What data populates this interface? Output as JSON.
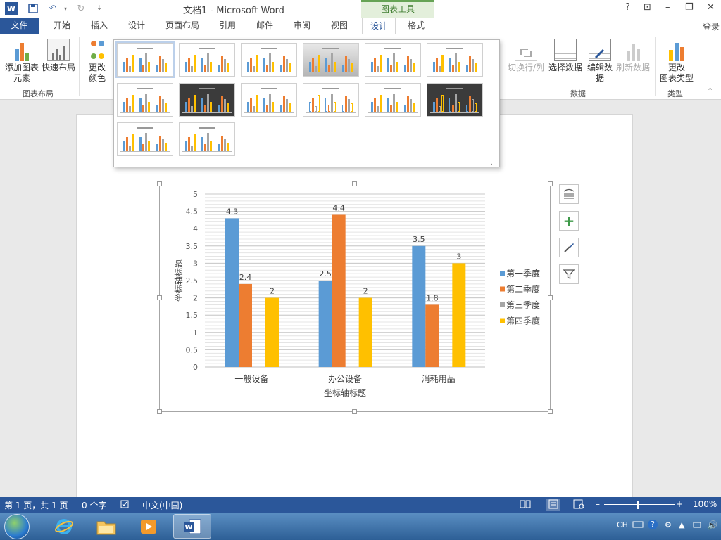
{
  "titlebar": {
    "title": "文档1 - Microsoft Word",
    "context_tab": "图表工具",
    "help": "?",
    "restore_ribbon": "⊡",
    "minimize": "–",
    "restore": "❐",
    "close": "✕"
  },
  "tabs": [
    {
      "label": "文件"
    },
    {
      "label": "开始"
    },
    {
      "label": "插入"
    },
    {
      "label": "设计"
    },
    {
      "label": "页面布局"
    },
    {
      "label": "引用"
    },
    {
      "label": "邮件"
    },
    {
      "label": "审阅"
    },
    {
      "label": "视图"
    },
    {
      "label": "设计"
    },
    {
      "label": "格式"
    }
  ],
  "login": "登录",
  "ribbon": {
    "add_element": [
      "添加图表",
      "元素"
    ],
    "quick_layout": "快速布局",
    "change_colors": [
      "更改",
      "颜色"
    ],
    "group_layout": "图表布局",
    "switch_row_col": "切换行/列",
    "select_data": "选择数据",
    "edit_data": [
      "编辑数",
      "据"
    ],
    "refresh_data": "刷新数据",
    "group_data": "数据",
    "change_type": [
      "更改",
      "图表类型"
    ],
    "group_type": "类型"
  },
  "colors": {
    "series1": "#5b9bd5",
    "series2": "#ed7d31",
    "series3": "#a5a5a5",
    "series4": "#ffc000",
    "accent": "#2b579a"
  },
  "chart_data": {
    "type": "bar",
    "categories": [
      "一般设备",
      "办公设备",
      "消耗用品"
    ],
    "series": [
      {
        "name": "第一季度",
        "values": [
          4.3,
          2.5,
          3.5
        ]
      },
      {
        "name": "第二季度",
        "values": [
          2.4,
          4.4,
          1.8
        ]
      },
      {
        "name": "第三季度",
        "values": [
          null,
          null,
          null
        ]
      },
      {
        "name": "第四季度",
        "values": [
          2,
          2,
          3
        ]
      }
    ],
    "xlabel": "坐标轴标题",
    "ylabel": "坐标轴标题",
    "ylim": [
      0,
      5
    ],
    "yticks": [
      "0",
      "0.5",
      "1",
      "1.5",
      "2",
      "2.5",
      "3",
      "3.5",
      "4",
      "4.5",
      "5"
    ],
    "grid": true,
    "legend_position": "right",
    "data_labels": true
  },
  "status": {
    "page": "第 1 页，共 1 页",
    "words": "0 个字",
    "language": "中文(中国)",
    "zoom": "100%",
    "zoom_minus": "–",
    "zoom_plus": "+"
  },
  "taskbar": {
    "ime": "CH",
    "help": "?"
  }
}
